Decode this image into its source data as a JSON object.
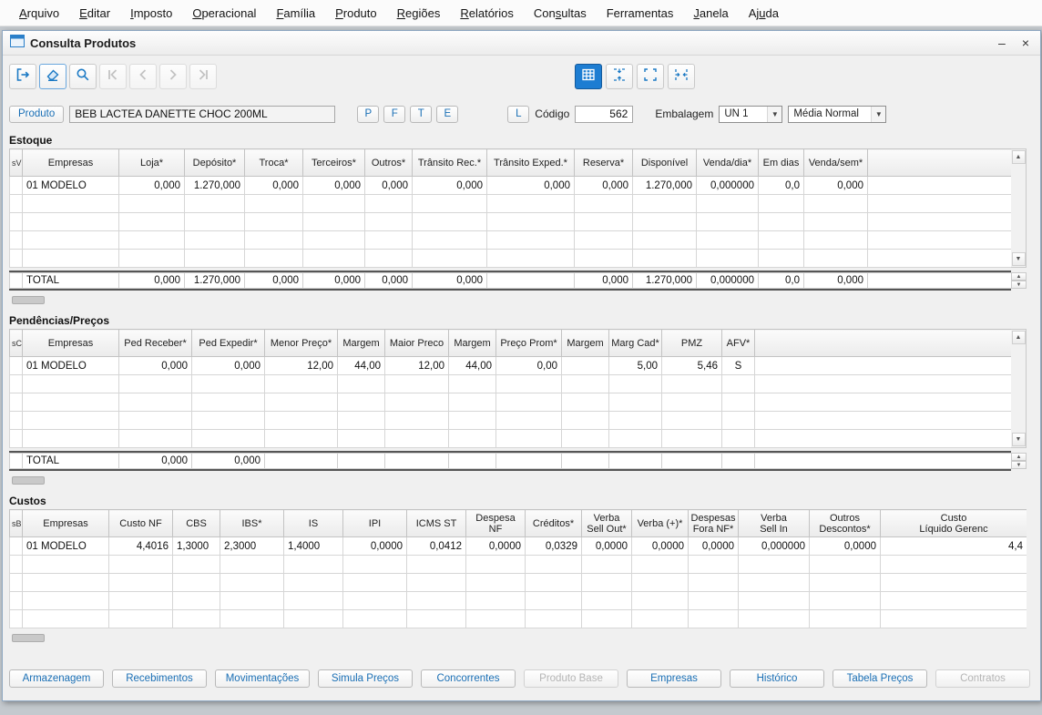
{
  "menu": {
    "items": [
      {
        "label": "Arquivo",
        "u": 0
      },
      {
        "label": "Editar",
        "u": 0
      },
      {
        "label": "Imposto",
        "u": 0
      },
      {
        "label": "Operacional",
        "u": 0
      },
      {
        "label": "Família",
        "u": 0
      },
      {
        "label": "Produto",
        "u": 0
      },
      {
        "label": "Regiões",
        "u": 0
      },
      {
        "label": "Relatórios",
        "u": 0
      },
      {
        "label": "Consultas",
        "u": 3
      },
      {
        "label": "Ferramentas",
        "u": -1
      },
      {
        "label": "Janela",
        "u": 0
      },
      {
        "label": "Ajuda",
        "u": 2
      }
    ]
  },
  "window": {
    "title": "Consulta Produtos",
    "minimize_glyph": "–",
    "close_glyph": "×"
  },
  "toolbar": {
    "buttons": [
      {
        "name": "exit-button",
        "icon": "door-exit-icon",
        "enabled": true,
        "focus": false
      },
      {
        "name": "clear-button",
        "icon": "eraser-icon",
        "enabled": true,
        "focus": true
      },
      {
        "name": "search-button",
        "icon": "magnifier-icon",
        "enabled": true,
        "focus": false
      },
      {
        "name": "nav-first-button",
        "icon": "first-record-icon",
        "enabled": false,
        "focus": false
      },
      {
        "name": "nav-prev-button",
        "icon": "prev-record-icon",
        "enabled": false,
        "focus": false
      },
      {
        "name": "nav-next-button",
        "icon": "next-record-icon",
        "enabled": false,
        "focus": false
      },
      {
        "name": "nav-last-button",
        "icon": "last-record-icon",
        "enabled": false,
        "focus": false
      }
    ],
    "view_buttons": [
      {
        "name": "grid-view-button",
        "icon": "grid-icon",
        "active": true
      },
      {
        "name": "collapse-grids-button",
        "icon": "collapse-vertical-icon",
        "active": false
      },
      {
        "name": "expand-grids-button",
        "icon": "expand-corners-icon",
        "active": false
      },
      {
        "name": "restore-grids-button",
        "icon": "collapse-horizontal-icon",
        "active": false
      }
    ]
  },
  "product_bar": {
    "produto_button": "Produto",
    "product_name": "BEB LACTEA DANETTE CHOC 200ML",
    "flag_buttons": [
      "P",
      "F",
      "T",
      "E"
    ],
    "list_button": "L",
    "codigo_label": "Código",
    "codigo_value": "562",
    "embalagem_label": "Embalagem",
    "embalagem_selected": "UN 1",
    "media_selected": "Média Normal"
  },
  "sections": {
    "estoque": {
      "title": "Estoque",
      "columns": [
        "sV",
        "Empresas",
        "Loja*",
        "Depósito*",
        "Troca*",
        "Terceiros*",
        "Outros*",
        "Trânsito Rec.*",
        "Trânsito Exped.*",
        "Reserva*",
        "Disponível",
        "Venda/dia*",
        "Em dias",
        "Venda/sem*",
        ""
      ],
      "rows": [
        [
          "",
          "01 MODELO",
          "0,000",
          "1.270,000",
          "0,000",
          "0,000",
          "0,000",
          "0,000",
          "0,000",
          "0,000",
          "1.270,000",
          "0,000000",
          "0,0",
          "0,000",
          ""
        ]
      ],
      "total": [
        "",
        "TOTAL",
        "0,000",
        "1.270,000",
        "0,000",
        "0,000",
        "0,000",
        "0,000",
        "",
        "0,000",
        "1.270,000",
        "0,000000",
        "0,0",
        "0,000",
        ""
      ]
    },
    "pendencias": {
      "title": "Pendências/Preços",
      "columns": [
        "sC",
        "Empresas",
        "Ped Receber*",
        "Ped Expedir*",
        "Menor Preço*",
        "Margem",
        "Maior Preco",
        "Margem",
        "Preço Prom*",
        "Margem",
        "Marg Cad*",
        "PMZ",
        "AFV*",
        ""
      ],
      "rows": [
        [
          "",
          "01 MODELO",
          "0,000",
          "0,000",
          "12,00",
          "44,00",
          "12,00",
          "44,00",
          "0,00",
          "",
          "5,00",
          "5,46",
          "S",
          ""
        ]
      ],
      "total": [
        "",
        "TOTAL",
        "0,000",
        "0,000",
        "",
        "",
        "",
        "",
        "",
        "",
        "",
        "",
        "",
        ""
      ]
    },
    "custos": {
      "title": "Custos",
      "columns": [
        "sB",
        "Empresas",
        "Custo NF",
        "CBS",
        "IBS*",
        "IS",
        "IPI",
        "ICMS ST",
        "Despesa NF",
        "Créditos*",
        "Verba\nSell Out*",
        "Verba (+)*",
        "Despesas\nFora NF*",
        "Verba\nSell In",
        "Outros\nDescontos*",
        "Custo\nLíquido Gerenc"
      ],
      "rows": [
        [
          "",
          "01 MODELO",
          "4,4016",
          "1,3000",
          "2,3000",
          "1,4000",
          "0,0000",
          "0,0412",
          "0,0000",
          "0,0329",
          "0,0000",
          "0,0000",
          "0,0000",
          "0,000000",
          "0,0000",
          "4,4"
        ]
      ],
      "total": null
    }
  },
  "footer": {
    "buttons": [
      {
        "label": "Armazenagem",
        "enabled": true
      },
      {
        "label": "Recebimentos",
        "enabled": true
      },
      {
        "label": "Movimentações",
        "enabled": true
      },
      {
        "label": "Simula Preços",
        "enabled": true
      },
      {
        "label": "Concorrentes",
        "enabled": true
      },
      {
        "label": "Produto Base",
        "enabled": false
      },
      {
        "label": "Empresas",
        "enabled": true
      },
      {
        "label": "Histórico",
        "enabled": true
      },
      {
        "label": "Tabela Preços",
        "enabled": true
      },
      {
        "label": "Contratos",
        "enabled": false
      }
    ]
  },
  "colors": {
    "accent_blue": "#1d7dd2",
    "button_text_blue": "#1a6fb5",
    "disabled_gray": "#b5b5b5"
  }
}
